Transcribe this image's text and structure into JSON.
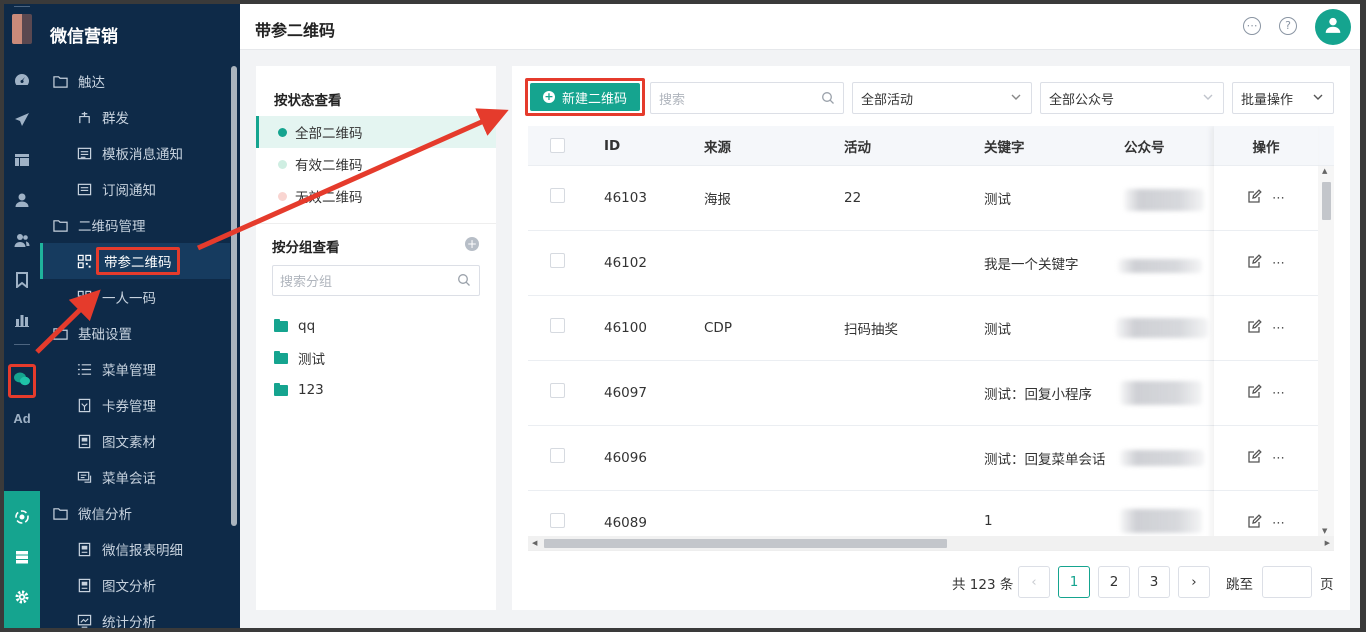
{
  "app": {
    "brand": "微信营销",
    "page_title": "带参二维码",
    "accent": "#15a48f",
    "sidebar_bg": "#0e2a48",
    "annotation_color": "#e53b2c"
  },
  "rail": {
    "icons": [
      "dashboard-icon",
      "send-icon",
      "layout-icon",
      "user-icon",
      "users-icon",
      "bookmark-icon",
      "bar-chart-icon",
      "wechat-icon"
    ],
    "ad_label": "Ad",
    "bottom_icons": [
      "hub-icon",
      "server-icon",
      "gear-icon"
    ]
  },
  "sidebar": {
    "groups": [
      {
        "label": "触达",
        "items": [
          "群发",
          "模板消息通知",
          "订阅通知"
        ]
      },
      {
        "label": "二维码管理",
        "items": [
          "带参二维码",
          "一人一码"
        ]
      },
      {
        "label": "基础设置",
        "items": [
          "菜单管理",
          "卡券管理",
          "图文素材",
          "菜单会话"
        ]
      },
      {
        "label": "微信分析",
        "items": [
          "微信报表明细",
          "图文分析",
          "统计分析"
        ]
      }
    ]
  },
  "filter": {
    "status_title": "按状态查看",
    "statuses": [
      {
        "label": "全部二维码",
        "color": "#15a48f"
      },
      {
        "label": "有效二维码",
        "color": "#cfeee2"
      },
      {
        "label": "无效二维码",
        "color": "#f9d5d1"
      }
    ],
    "group_title": "按分组查看",
    "group_search_placeholder": "搜索分组",
    "folders": [
      "qq",
      "测试",
      "123"
    ]
  },
  "toolbar": {
    "new_button": "新建二维码",
    "search_placeholder": "搜索",
    "activity_select": "全部活动",
    "account_select": "全部公众号",
    "batch_button": "批量操作"
  },
  "table": {
    "columns": [
      "ID",
      "来源",
      "活动",
      "关键字",
      "公众号",
      "操作"
    ],
    "rows": [
      {
        "id": "46103",
        "source": "海报",
        "activity": "22",
        "keyword": "测试"
      },
      {
        "id": "46102",
        "source": "",
        "activity": "",
        "keyword": "我是一个关键字"
      },
      {
        "id": "46100",
        "source": "CDP",
        "activity": "扫码抽奖",
        "keyword": "测试"
      },
      {
        "id": "46097",
        "source": "",
        "activity": "",
        "keyword": "测试：回复小程序"
      },
      {
        "id": "46096",
        "source": "",
        "activity": "",
        "keyword": "测试：回复菜单会话"
      },
      {
        "id": "46089",
        "source": "",
        "activity": "",
        "keyword": "1"
      }
    ]
  },
  "pagination": {
    "total": "共 123 条",
    "pages": [
      "1",
      "2",
      "3"
    ],
    "current": "1",
    "jump_label": "跳至",
    "page_suffix": "页"
  }
}
